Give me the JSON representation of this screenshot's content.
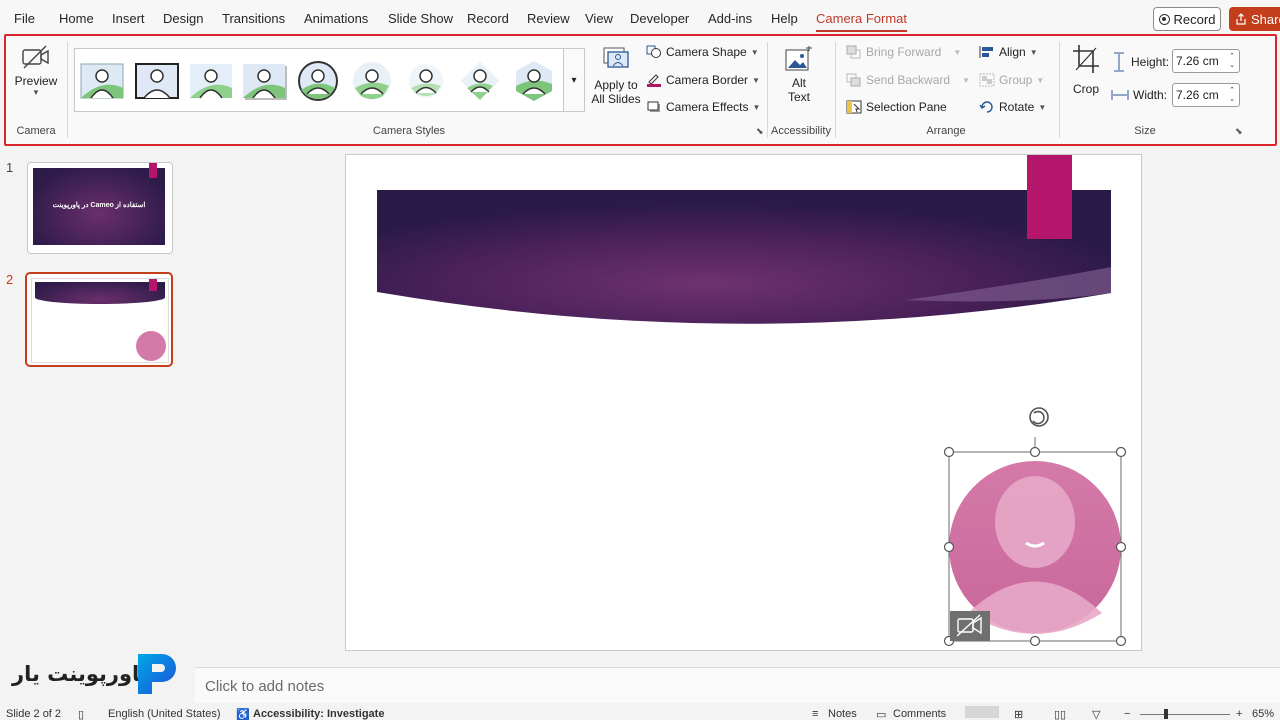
{
  "menu": {
    "tabs": [
      {
        "label": "File"
      },
      {
        "label": "Home"
      },
      {
        "label": "Insert"
      },
      {
        "label": "Design"
      },
      {
        "label": "Transitions"
      },
      {
        "label": "Animations"
      },
      {
        "label": "Slide Show"
      },
      {
        "label": "Record"
      },
      {
        "label": "Review"
      },
      {
        "label": "View"
      },
      {
        "label": "Developer"
      },
      {
        "label": "Add-ins"
      },
      {
        "label": "Help"
      },
      {
        "label": "Camera Format"
      }
    ],
    "record_label": "Record",
    "share_label": "Share",
    "accent": "#c43e1c"
  },
  "ribbon": {
    "camera": {
      "preview_label": "Preview",
      "group_label": "Camera"
    },
    "styles": {
      "group_label": "Camera Styles",
      "apply_line1": "Apply to",
      "apply_line2": "All Slides"
    },
    "shape_label": "Camera Shape",
    "border_label": "Camera Border",
    "effects_label": "Camera Effects",
    "accessibility": {
      "alt_line1": "Alt",
      "alt_line2": "Text",
      "group_label": "Accessibility"
    },
    "arrange": {
      "bring_forward": "Bring Forward",
      "send_backward": "Send Backward",
      "selection_pane": "Selection Pane",
      "align": "Align",
      "group": "Group",
      "rotate": "Rotate",
      "group_label": "Arrange"
    },
    "size": {
      "crop": "Crop",
      "height_label": "Height:",
      "height_value": "7.26 cm",
      "width_label": "Width:",
      "width_value": "7.26 cm",
      "group_label": "Size"
    }
  },
  "slides": [
    {
      "number": "1",
      "title": "استفاده از Cameo در پاورپوینت"
    },
    {
      "number": "2"
    }
  ],
  "notes_placeholder": "Click to add notes",
  "status": {
    "slide_count": "Slide 2 of 2",
    "language": "English (United States)",
    "accessibility": "Accessibility: Investigate",
    "notes": "Notes",
    "comments": "Comments",
    "zoom": "65%"
  },
  "logo_text": "پاورپوینت یار",
  "colors": {
    "banner_dark": "#2d1b4a",
    "banner_mid": "#6b2f6b",
    "tab_pink": "#b5156a",
    "cameo_pink": "#d47aa8"
  }
}
